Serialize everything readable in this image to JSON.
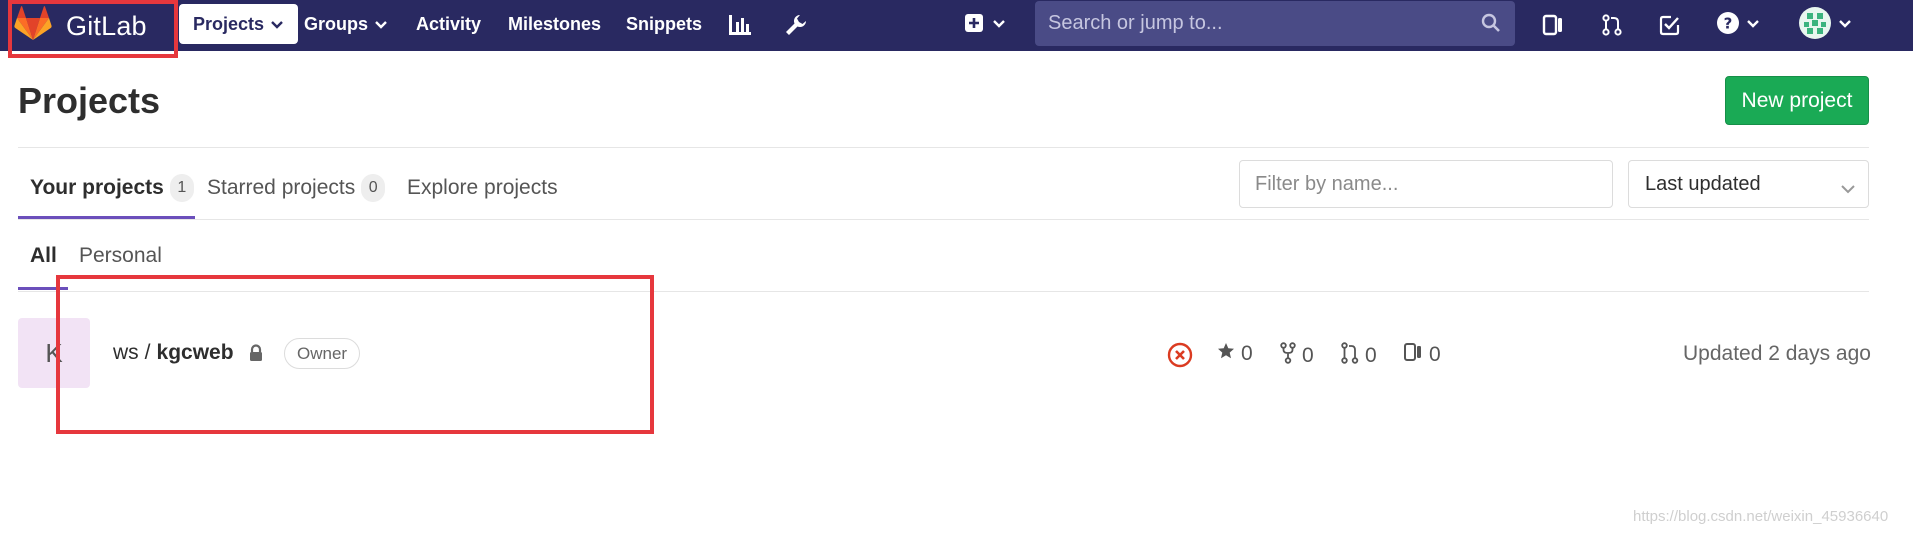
{
  "navbar": {
    "brand": "GitLab",
    "items": [
      {
        "label": "Projects",
        "active": true,
        "has_dropdown": true
      },
      {
        "label": "Groups",
        "has_dropdown": true
      },
      {
        "label": "Activity"
      },
      {
        "label": "Milestones"
      },
      {
        "label": "Snippets"
      }
    ],
    "icons": [
      "chart-icon",
      "wrench-icon",
      "plus-square-icon",
      "issues-icon",
      "merge-request-icon",
      "todo-check-icon",
      "help-icon",
      "avatar"
    ],
    "search_placeholder": "Search or jump to..."
  },
  "page": {
    "title": "Projects",
    "new_project_label": "New project",
    "tabs": [
      {
        "label": "Your projects",
        "count": "1",
        "active": true
      },
      {
        "label": "Starred projects",
        "count": "0"
      },
      {
        "label": "Explore projects"
      }
    ],
    "filter_placeholder": "Filter by name...",
    "sort_selected": "Last updated",
    "subtabs": [
      {
        "label": "All",
        "active": true
      },
      {
        "label": "Personal"
      }
    ]
  },
  "projects": [
    {
      "avatar_letter": "K",
      "namespace": "ws",
      "separator": "/",
      "name": "kgcweb",
      "visibility": "private",
      "role": "Owner",
      "pipeline_status": "failed",
      "stars": "0",
      "forks": "0",
      "merge_requests": "0",
      "issues": "0",
      "updated": "Updated 2 days ago"
    }
  ],
  "watermark": "https://blog.csdn.net/weixin_45936640",
  "colors": {
    "navbar": "#292961",
    "search": "#4a4b86",
    "accent": "#6b4fbb",
    "new_button": "#1aaa55",
    "annotation": "#e6373d",
    "failed": "#db3b21"
  }
}
